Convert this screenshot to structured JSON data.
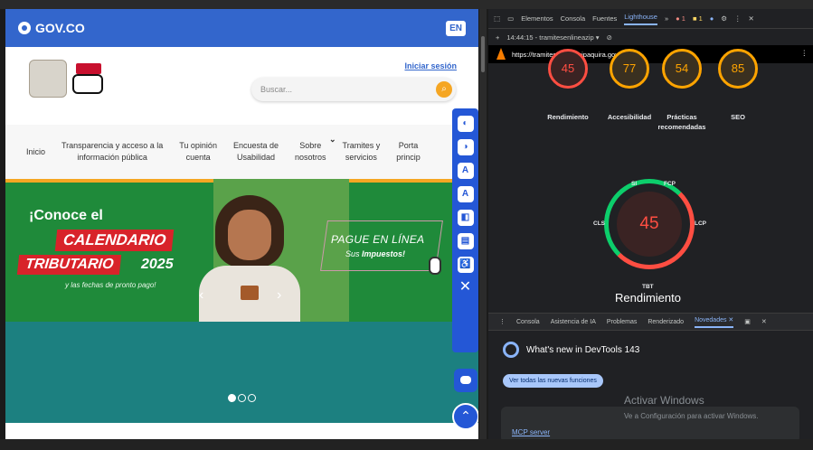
{
  "site": {
    "gov_logo": "GOV.CO",
    "lang": "EN",
    "login": "Iniciar sesión",
    "search_placeholder": "Buscar...",
    "nav": [
      {
        "label": "Inicio"
      },
      {
        "label": "Transparencia y acceso a la\ninformación pública"
      },
      {
        "label": "Tu opinión\ncuenta"
      },
      {
        "label": "Encuesta de\nUsabilidad"
      },
      {
        "label": "Sobre\nnosotros"
      },
      {
        "label": "Tramites y\nservicios"
      },
      {
        "label": "Porta\nprincip"
      }
    ],
    "hero": {
      "conoce": "¡Conoce el",
      "calendario": "CALENDARIO",
      "tributario": "TRIBUTARIO",
      "year": "2025",
      "fechas": "y las fechas de pronto pago!",
      "pague": "PAGUE EN LÍNEA",
      "sus": "Sus",
      "impuestos": "Impuestos!"
    },
    "icons": {
      "search": "search-icon",
      "chevron": "chevron-down-icon",
      "close": "close-icon",
      "up": "arrow-up-icon"
    },
    "colors": {
      "gov_blue": "#3366cc",
      "hero_green": "#1f8a3a",
      "accent_red": "#d8232a",
      "teal": "#1c8080"
    }
  },
  "devtools": {
    "tabs": [
      "Elementos",
      "Consola",
      "Fuentes",
      "Lighthouse"
    ],
    "more": "»",
    "errors": "1",
    "warnings": "1",
    "timestamp": "14:44:15 - tramitesenlineazip",
    "url": "https://tramitesenlineazipaquira.gov.co/",
    "scores": [
      {
        "label": "Rendimiento",
        "value": "45",
        "color": "#ff4e42"
      },
      {
        "label": "Accesibilidad",
        "value": "77",
        "color": "#ffa400"
      },
      {
        "label": "Prácticas\nrecomendadas",
        "value": "54",
        "color": "#ffa400"
      },
      {
        "label": "SEO",
        "value": "85",
        "color": "#ffa400"
      }
    ],
    "big_score": "45",
    "metrics": {
      "si": "SI",
      "fcp": "FCP",
      "cls": "CLS",
      "lcp": "LCP",
      "tbt": "TBT"
    },
    "rend_label": "Rendimiento",
    "drawer_tabs": [
      "Consola",
      "Asistencia de IA",
      "Problemas",
      "Renderizado",
      "Novedades"
    ],
    "whats_new": "What's new in DevTools 143",
    "ver_todas": "Ver todas las nuevas funciones",
    "mcp": "MCP server",
    "activate": "Activar Windows",
    "activate_sub": "Ve a Configuración para activar Windows."
  }
}
